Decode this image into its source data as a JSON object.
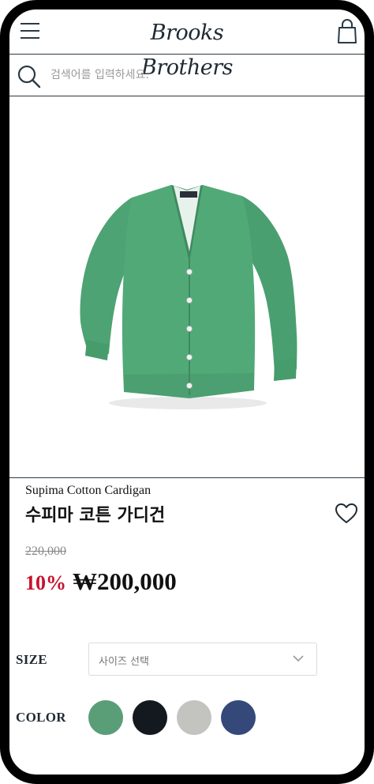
{
  "header": {
    "brand": "Brooks Brothers"
  },
  "search": {
    "placeholder": "검색어를 입력하세요."
  },
  "product": {
    "name_en": "Supima Cotton Cardigan",
    "name_ko": "수피마 코튼 가디건",
    "original_price": "220,000",
    "discount": "10%",
    "sale_price": "₩200,000"
  },
  "options": {
    "size_label": "SIZE",
    "size_placeholder": "사이즈 선택",
    "color_label": "COLOR",
    "colors": [
      "#5a9e78",
      "#141920",
      "#c3c4c0",
      "#34497a"
    ]
  },
  "icons": [
    "menu-icon",
    "bag-icon",
    "search-icon",
    "heart-icon",
    "chevron-down-icon"
  ]
}
